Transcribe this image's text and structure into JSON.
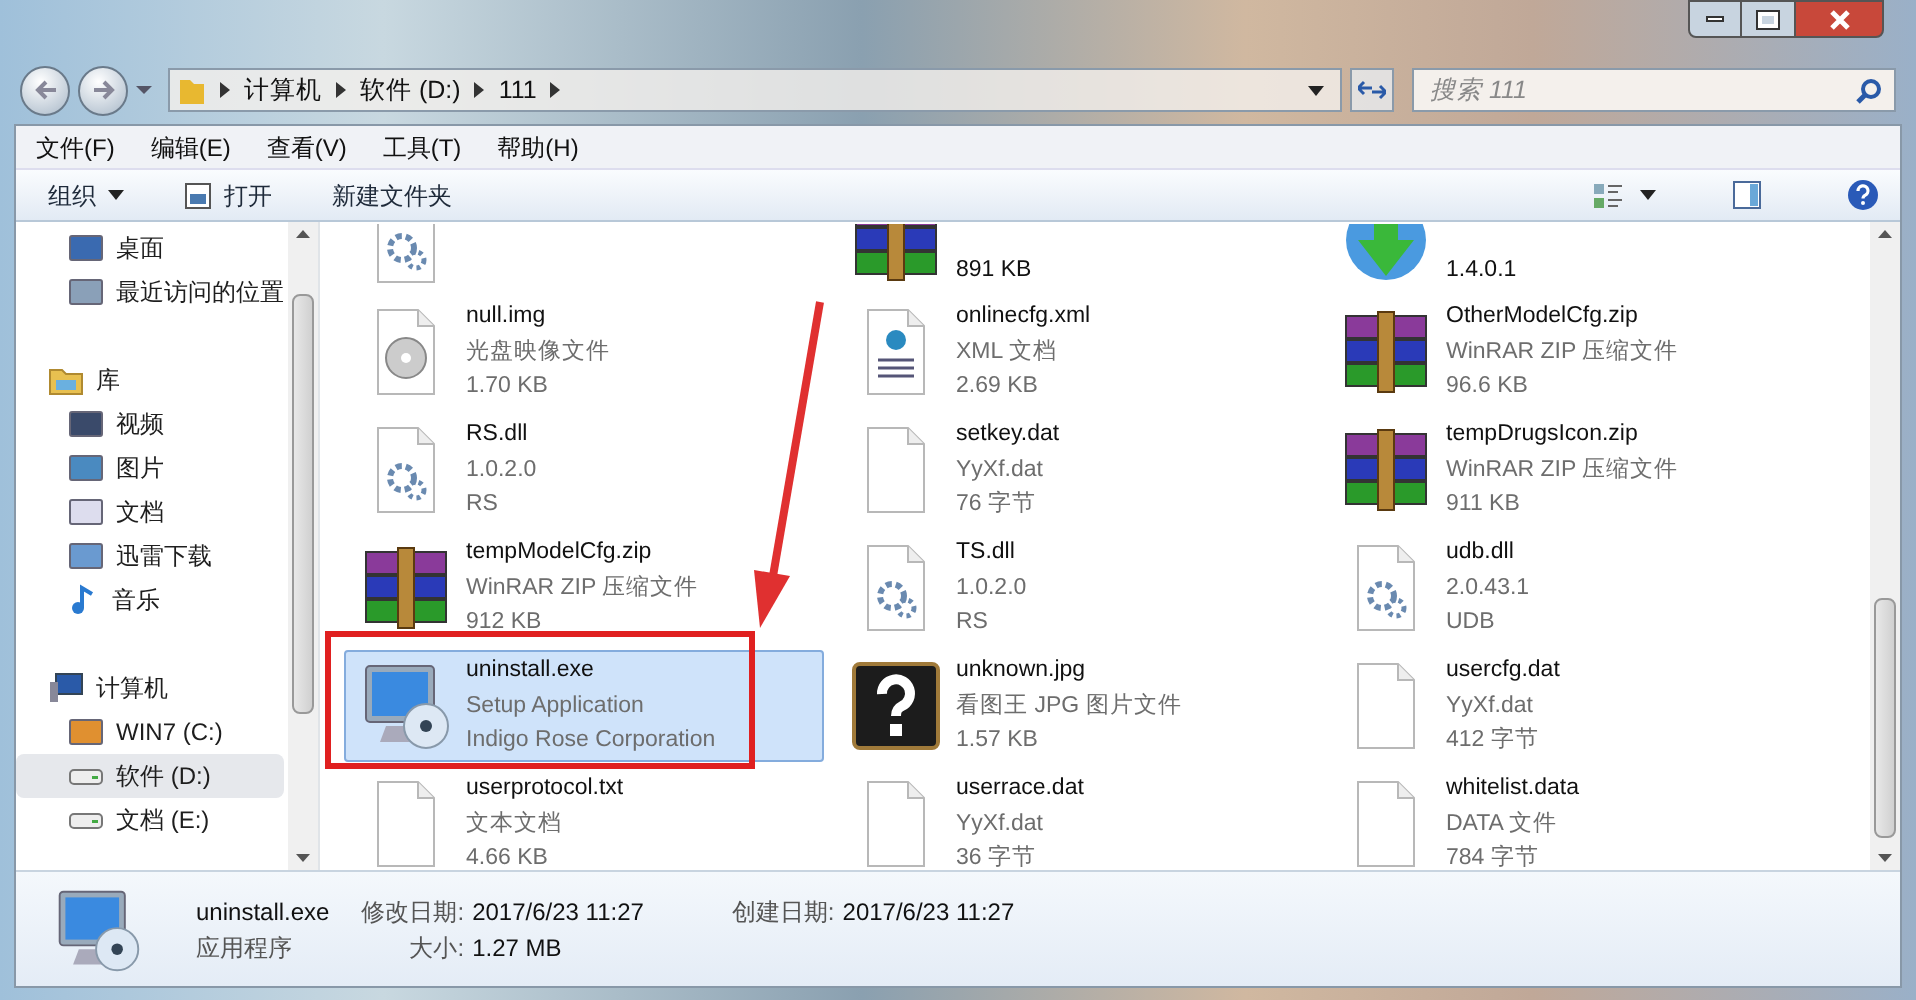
{
  "address_bar": {
    "crumbs": [
      "计算机",
      "软件 (D:)",
      "111"
    ]
  },
  "search": {
    "placeholder": "搜索 111"
  },
  "menu_bar": [
    "文件(F)",
    "编辑(E)",
    "查看(V)",
    "工具(T)",
    "帮助(H)"
  ],
  "toolbar": [
    {
      "label": "组织",
      "kind": "dropdown"
    },
    {
      "label": "打开",
      "kind": "open"
    },
    {
      "label": "新建文件夹",
      "kind": "plain"
    }
  ],
  "sidebar": {
    "groups": [
      {
        "items": [
          {
            "label": "桌面",
            "kind": "desktop",
            "selected": false
          },
          {
            "label": "最近访问的位置",
            "kind": "recent",
            "selected": false
          }
        ]
      },
      {
        "items": [
          {
            "label": "库",
            "kind": "library",
            "selected": false,
            "children": [
              {
                "label": "视频",
                "kind": "video",
                "selected": false
              },
              {
                "label": "图片",
                "kind": "pictures",
                "selected": false
              },
              {
                "label": "文档",
                "kind": "docs",
                "selected": false
              },
              {
                "label": "迅雷下载",
                "kind": "download",
                "selected": false
              },
              {
                "label": "音乐",
                "kind": "music",
                "selected": false
              }
            ]
          }
        ]
      },
      {
        "items": [
          {
            "label": "计算机",
            "kind": "computer",
            "selected": false,
            "children": [
              {
                "label": "WIN7 (C:)",
                "kind": "sysdrive",
                "selected": false
              },
              {
                "label": "软件 (D:)",
                "kind": "drive",
                "selected": true
              },
              {
                "label": "文档 (E:)",
                "kind": "drive",
                "selected": false
              }
            ]
          }
        ]
      }
    ]
  },
  "files": [
    {
      "kind": "gear",
      "selected": false
    },
    {
      "kind": "zip",
      "lines": [
        "891 KB"
      ],
      "selected": false
    },
    {
      "kind": "update",
      "lines": [
        "1.4.0.1"
      ],
      "selected": false
    },
    {
      "kind": "disc",
      "lines": [
        "null.img",
        "光盘映像文件",
        "1.70 KB"
      ],
      "selected": false
    },
    {
      "kind": "xml",
      "lines": [
        "onlinecfg.xml",
        "XML 文档",
        "2.69 KB"
      ],
      "selected": false
    },
    {
      "kind": "zip",
      "lines": [
        "OtherModelCfg.zip",
        "WinRAR ZIP 压缩文件",
        "96.6 KB"
      ],
      "selected": false
    },
    {
      "kind": "gear",
      "lines": [
        "RS.dll",
        "1.0.2.0",
        "RS"
      ],
      "selected": false
    },
    {
      "kind": "blank",
      "lines": [
        "setkey.dat",
        "YyXf.dat",
        "76 字节"
      ],
      "selected": false
    },
    {
      "kind": "zip",
      "lines": [
        "tempDrugsIcon.zip",
        "WinRAR ZIP 压缩文件",
        "911 KB"
      ],
      "selected": false
    },
    {
      "kind": "zip",
      "lines": [
        "tempModelCfg.zip",
        "WinRAR ZIP 压缩文件",
        "912 KB"
      ],
      "selected": false
    },
    {
      "kind": "gear",
      "lines": [
        "TS.dll",
        "1.0.2.0",
        "RS"
      ],
      "selected": false
    },
    {
      "kind": "gear",
      "lines": [
        "udb.dll",
        "2.0.43.1",
        "UDB"
      ],
      "selected": false
    },
    {
      "kind": "setup",
      "lines": [
        "uninstall.exe",
        "Setup Application",
        "Indigo Rose Corporation"
      ],
      "selected": true
    },
    {
      "kind": "image",
      "lines": [
        "unknown.jpg",
        "看图王 JPG 图片文件",
        "1.57 KB"
      ],
      "selected": false
    },
    {
      "kind": "blank",
      "lines": [
        "usercfg.dat",
        "YyXf.dat",
        "412 字节"
      ],
      "selected": false
    },
    {
      "kind": "blank",
      "lines": [
        "userprotocol.txt",
        "文本文档",
        "4.66 KB"
      ],
      "selected": false
    },
    {
      "kind": "blank",
      "lines": [
        "userrace.dat",
        "YyXf.dat",
        "36 字节"
      ],
      "selected": false
    },
    {
      "kind": "blank",
      "lines": [
        "whitelist.data",
        "DATA 文件",
        "784 字节"
      ],
      "selected": false
    }
  ],
  "details": {
    "name": "uninstall.exe",
    "type": "应用程序",
    "fields": [
      {
        "label": "修改日期:",
        "value": "2017/6/23 11:27"
      },
      {
        "label": "大小:",
        "value": "1.27 MB"
      },
      {
        "label": "创建日期:",
        "value": "2017/6/23 11:27"
      }
    ]
  }
}
